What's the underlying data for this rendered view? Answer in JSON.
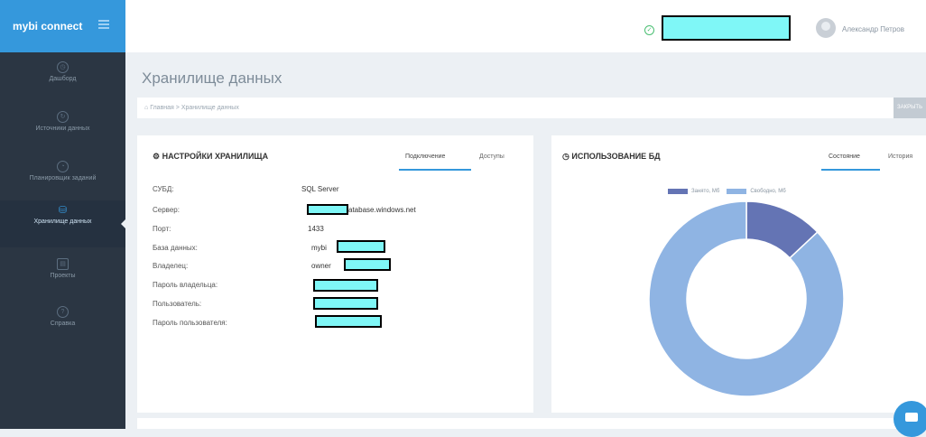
{
  "app": {
    "brand": "mybi connect"
  },
  "sidebar": {
    "items": [
      {
        "label": "Дашборд",
        "icon": "dashboard-icon"
      },
      {
        "label": "Источники данных",
        "icon": "sources-icon"
      },
      {
        "label": "Планировщик заданий",
        "icon": "scheduler-icon"
      },
      {
        "label": "Хранилище данных",
        "icon": "database-icon",
        "active": true
      },
      {
        "label": "Проекты",
        "icon": "projects-icon"
      },
      {
        "label": "Справка",
        "icon": "help-icon"
      }
    ]
  },
  "header": {
    "user_name": "Александр Петров"
  },
  "page": {
    "title": "Хранилище данных"
  },
  "breadcrumb": {
    "home": "Главная",
    "separator": ">",
    "current": "Хранилище данных",
    "action_label": "ЗАКРЫТЬ"
  },
  "settings_card": {
    "title": "НАСТРОЙКИ ХРАНИЛИЩА",
    "tabs": [
      "Подключение",
      "Доступы"
    ],
    "rows": [
      {
        "label": "СУБД:",
        "value": "SQL Server"
      },
      {
        "label": "Сервер:",
        "value": "atabase.windows.net"
      },
      {
        "label": "Порт:",
        "value": "1433"
      },
      {
        "label": "База данных:",
        "value": "mybi"
      },
      {
        "label": "Владелец:",
        "value": "owner"
      },
      {
        "label": "Пароль владельца:",
        "value": ""
      },
      {
        "label": "Пользователь:",
        "value": ""
      },
      {
        "label": "Пароль пользователя:",
        "value": ""
      }
    ]
  },
  "usage_card": {
    "title": "ИСПОЛЬЗОВАНИЕ БД",
    "tabs": [
      "Состояние",
      "История"
    ],
    "legend": [
      {
        "label": "Занято, Мб",
        "color": "#6474b4"
      },
      {
        "label": "Свободно, Мб",
        "color": "#8fb4e3"
      }
    ]
  },
  "chart_data": {
    "type": "pie",
    "categories": [
      "Занято, Мб",
      "Свободно, Мб"
    ],
    "values": [
      13,
      87
    ],
    "colors": [
      "#6474b4",
      "#8fb4e3"
    ],
    "legend_position": "top"
  }
}
